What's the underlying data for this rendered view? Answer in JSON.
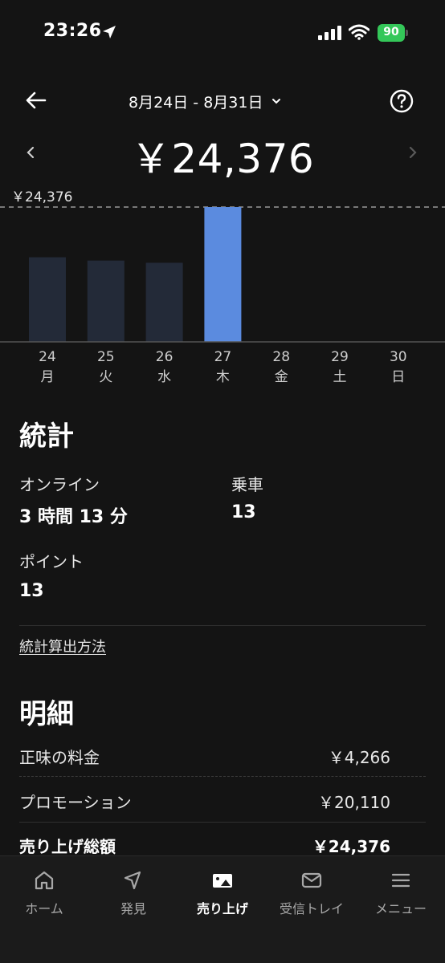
{
  "status_bar": {
    "time": "23:26",
    "battery": "90"
  },
  "header": {
    "date_range": "8月24日 - 8月31日",
    "total": "￥24,376"
  },
  "chart_data": {
    "type": "bar",
    "categories": [
      "24",
      "25",
      "26",
      "27",
      "28",
      "29",
      "30"
    ],
    "weekdays": [
      "月",
      "火",
      "水",
      "木",
      "金",
      "土",
      "日"
    ],
    "values": [
      15300,
      14700,
      14300,
      24376,
      0,
      0,
      0
    ],
    "max_label": "￥24,376",
    "ylim": [
      0,
      24376
    ],
    "highlight_index": 3,
    "colors": {
      "bar": "#232a38",
      "highlight": "#5b8bdf",
      "baseline": "#555555",
      "max_line": "#9a9a9a"
    }
  },
  "stats": {
    "title": "統計",
    "online_label": "オンライン",
    "online_value": "3 時間 13 分",
    "rides_label": "乗車",
    "rides_value": "13",
    "points_label": "ポイント",
    "points_value": "13",
    "method_link": "統計算出方法"
  },
  "details": {
    "title": "明細",
    "rows": [
      {
        "label": "正味の料金",
        "amount": "￥4,266"
      },
      {
        "label": "プロモーション",
        "amount": "￥20,110"
      },
      {
        "label": "売り上げ総額",
        "amount": "￥24,376"
      }
    ]
  },
  "nav": {
    "items": [
      {
        "label": "ホーム",
        "icon": "home-icon"
      },
      {
        "label": "発見",
        "icon": "compass-icon"
      },
      {
        "label": "売り上げ",
        "icon": "earnings-icon"
      },
      {
        "label": "受信トレイ",
        "icon": "inbox-icon"
      },
      {
        "label": "メニュー",
        "icon": "menu-icon"
      }
    ],
    "active": 2
  }
}
